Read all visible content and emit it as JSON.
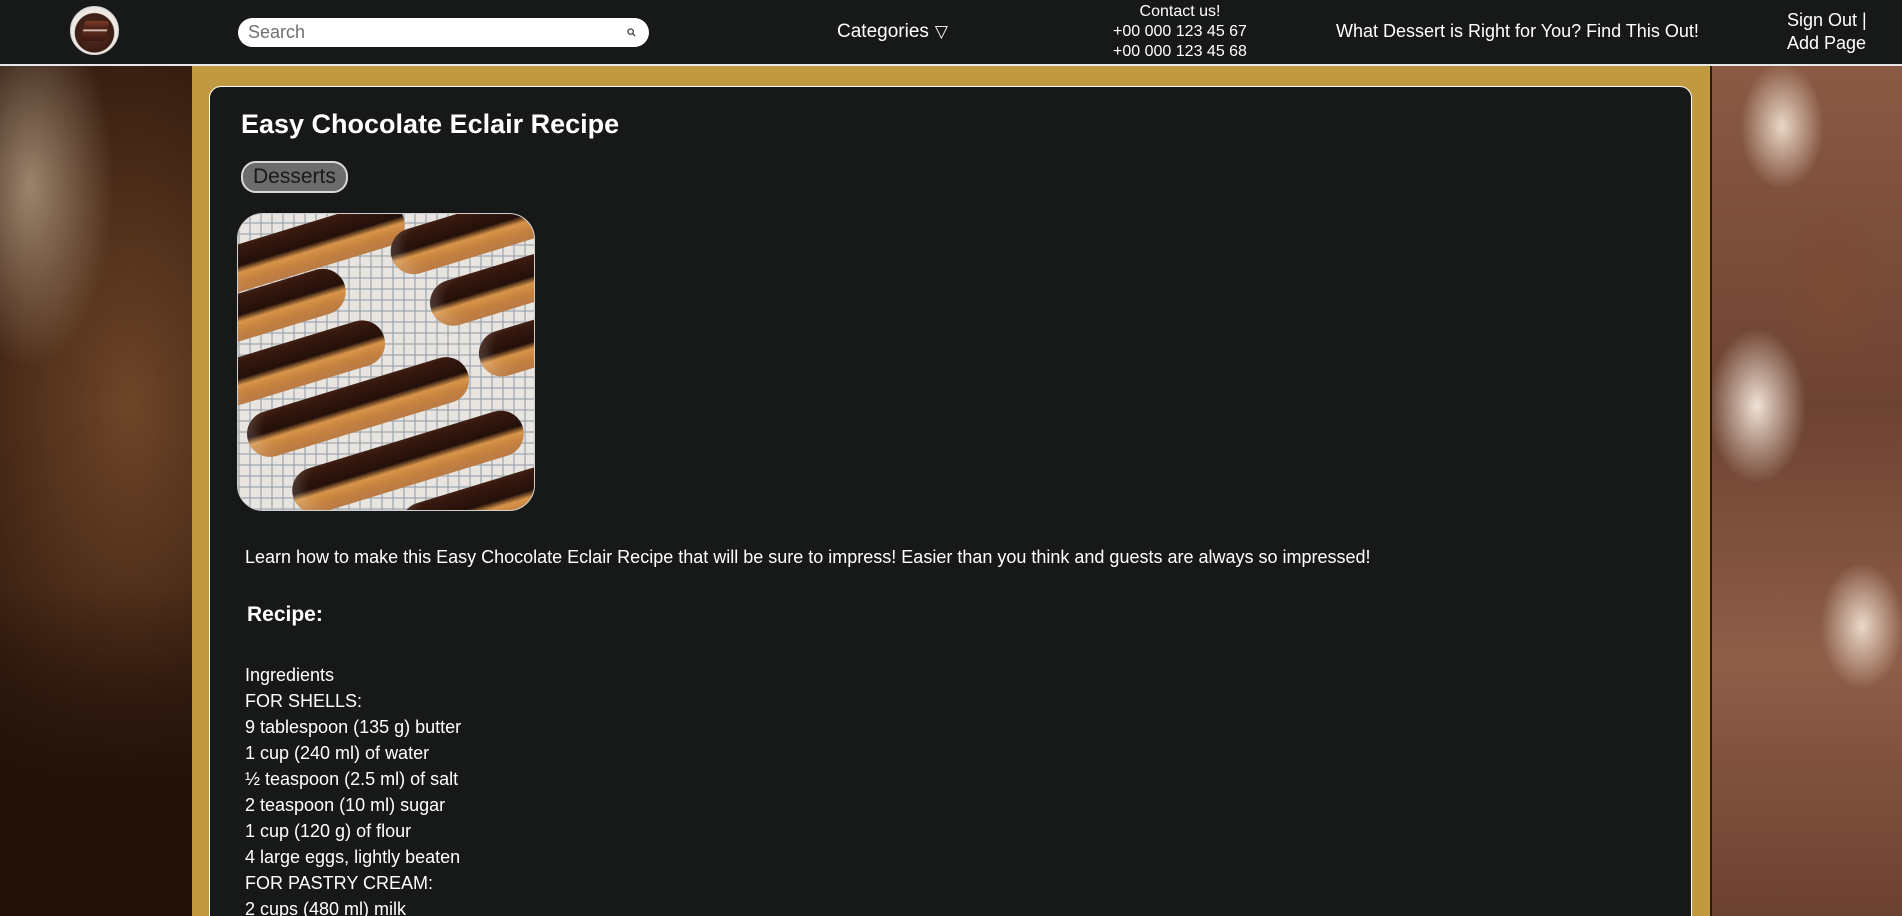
{
  "header": {
    "search_placeholder": "Search",
    "categories_label": "Categories",
    "categories_icon": "▽",
    "contact": {
      "title": "Contact us!",
      "phone1": "+00 000 123 45 67",
      "phone2": "+00 000 123 45 68"
    },
    "quiz_link": "What Dessert is Right for You? Find This Out!",
    "sign_out": "Sign Out |",
    "add_page": "Add Page"
  },
  "article": {
    "title": "Easy Chocolate Eclair Recipe",
    "tag": "Desserts",
    "intro": "Learn how to make this Easy Chocolate Eclair Recipe that will be sure to impress! Easier than you think and guests are always so impressed!",
    "recipe_heading": "Recipe:",
    "ingredients": [
      "Ingredients",
      "FOR SHELLS:",
      "9 tablespoon (135 g) butter",
      "1 cup (240 ml) of water",
      "½ teaspoon (2.5 ml) of salt",
      "2 teaspoon (10 ml) sugar",
      "1 cup (120 g) of flour",
      "4 large eggs, lightly beaten",
      "FOR PASTRY CREAM:",
      "2 cups (480 ml) milk"
    ]
  },
  "colors": {
    "header_bg": "#171918",
    "frame_gold": "#c19940",
    "card_bg": "#171918",
    "tag_bg": "#6c6c6c",
    "text": "#ffffff"
  },
  "icons": {
    "logo": "cake-logo-icon",
    "search": "search-icon",
    "categories": "triangle-down-icon"
  }
}
